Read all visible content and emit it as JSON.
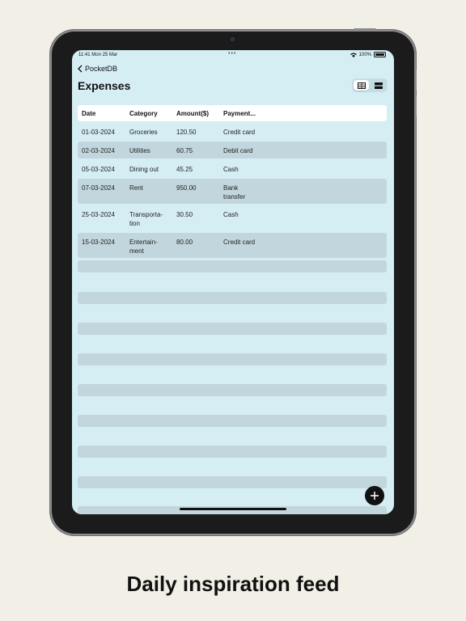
{
  "status_bar": {
    "time": "11:41",
    "date": "Mon 25 Mar",
    "battery": "100%"
  },
  "nav": {
    "back_label": "PocketDB",
    "title": "Expenses"
  },
  "table": {
    "headers": [
      "Date",
      "Category",
      "Amount($)",
      "Payment..."
    ],
    "rows": [
      [
        "01-03-2024",
        "Groceries",
        "120.50",
        "Credit card"
      ],
      [
        "02-03-2024",
        "Utilities",
        "60.75",
        "Debit card"
      ],
      [
        "05-03-2024",
        "Dining out",
        "45.25",
        "Cash"
      ],
      [
        "07-03-2024",
        "Rent",
        "950.00",
        "Bank transfer"
      ],
      [
        "25-03-2024",
        "Transporta-tion",
        "30.50",
        "Cash"
      ],
      [
        "15-03-2024",
        "Entertain-ment",
        "80.00",
        "Credit card"
      ]
    ]
  },
  "caption": "Daily inspiration feed"
}
